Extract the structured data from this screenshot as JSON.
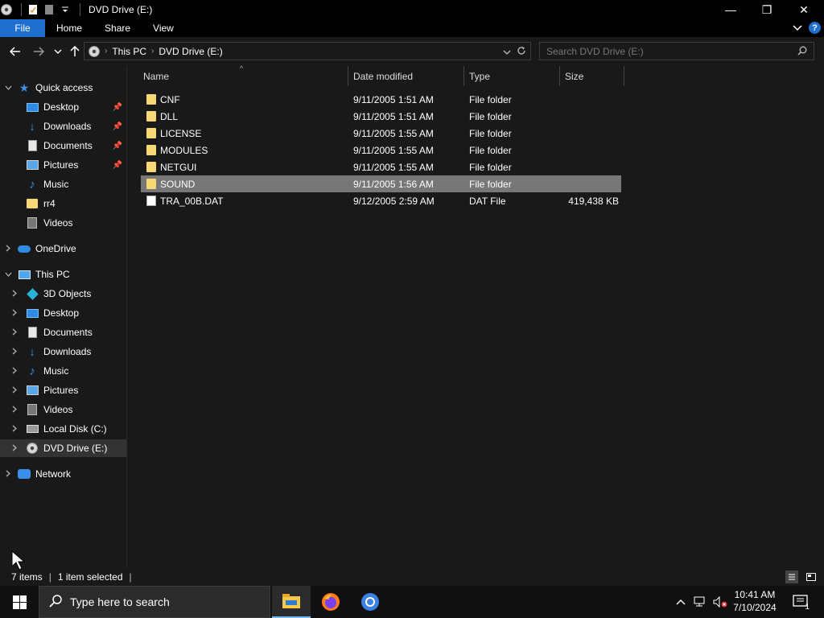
{
  "window": {
    "title": "DVD Drive (E:)",
    "controls": {
      "minimize": "—",
      "restore": "❐",
      "close": "✕"
    }
  },
  "ribbon": {
    "tabs": [
      "File",
      "Home",
      "Share",
      "View"
    ],
    "help": "?"
  },
  "address": {
    "breadcrumbs": [
      "This PC",
      "DVD Drive (E:)"
    ],
    "search_placeholder": "Search DVD Drive (E:)"
  },
  "nav": {
    "quick_access": {
      "label": "Quick access",
      "items": [
        {
          "label": "Desktop",
          "icon": "desktop-icon",
          "pinned": true
        },
        {
          "label": "Downloads",
          "icon": "downloads-icon",
          "pinned": true
        },
        {
          "label": "Documents",
          "icon": "documents-icon",
          "pinned": true
        },
        {
          "label": "Pictures",
          "icon": "pictures-icon",
          "pinned": true
        },
        {
          "label": "Music",
          "icon": "music-icon",
          "pinned": false
        },
        {
          "label": "rr4",
          "icon": "folder-icon",
          "pinned": false
        },
        {
          "label": "Videos",
          "icon": "videos-icon",
          "pinned": false
        }
      ]
    },
    "onedrive": "OneDrive",
    "this_pc": {
      "label": "This PC",
      "items": [
        {
          "label": "3D Objects",
          "icon": "3d-objects-icon"
        },
        {
          "label": "Desktop",
          "icon": "desktop-icon"
        },
        {
          "label": "Documents",
          "icon": "documents-icon"
        },
        {
          "label": "Downloads",
          "icon": "downloads-icon"
        },
        {
          "label": "Music",
          "icon": "music-icon"
        },
        {
          "label": "Pictures",
          "icon": "pictures-icon"
        },
        {
          "label": "Videos",
          "icon": "videos-icon"
        },
        {
          "label": "Local Disk (C:)",
          "icon": "local-disk-icon"
        },
        {
          "label": "DVD Drive (E:)",
          "icon": "dvd-drive-icon",
          "selected": true
        }
      ]
    },
    "network": "Network"
  },
  "columns": {
    "name": "Name",
    "date": "Date modified",
    "type": "Type",
    "size": "Size"
  },
  "files": [
    {
      "name": "CNF",
      "date": "9/11/2005 1:51 AM",
      "type": "File folder",
      "size": "",
      "kind": "folder"
    },
    {
      "name": "DLL",
      "date": "9/11/2005 1:51 AM",
      "type": "File folder",
      "size": "",
      "kind": "folder"
    },
    {
      "name": "LICENSE",
      "date": "9/11/2005 1:55 AM",
      "type": "File folder",
      "size": "",
      "kind": "folder"
    },
    {
      "name": "MODULES",
      "date": "9/11/2005 1:55 AM",
      "type": "File folder",
      "size": "",
      "kind": "folder"
    },
    {
      "name": "NETGUI",
      "date": "9/11/2005 1:55 AM",
      "type": "File folder",
      "size": "",
      "kind": "folder"
    },
    {
      "name": "SOUND",
      "date": "9/11/2005 1:56 AM",
      "type": "File folder",
      "size": "",
      "kind": "folder",
      "selected": true
    },
    {
      "name": "TRA_00B.DAT",
      "date": "9/12/2005 2:59 AM",
      "type": "DAT File",
      "size": "419,438 KB",
      "kind": "file"
    }
  ],
  "status": {
    "item_count": "7 items",
    "selection": "1 item selected"
  },
  "taskbar": {
    "search_placeholder": "Type here to search",
    "time": "10:41 AM",
    "date": "7/10/2024",
    "notification_count": "1"
  },
  "colors": {
    "accent": "#1f6fd0",
    "background": "#191919",
    "selection": "#777777",
    "folder": "#f8d775"
  }
}
